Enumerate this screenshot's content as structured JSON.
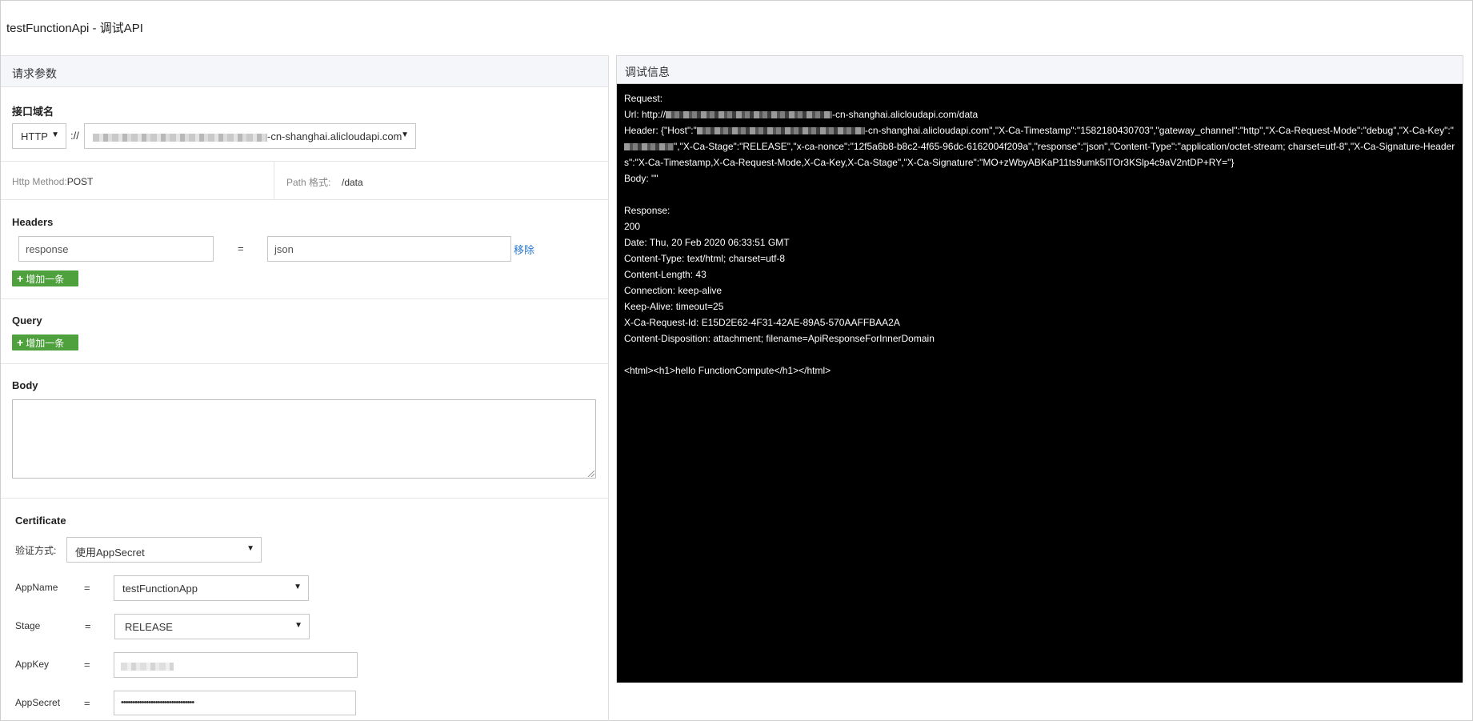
{
  "page": {
    "title": "testFunctionApi - 调试API"
  },
  "request_panel": {
    "heading": "请求参数",
    "domain": {
      "label": "接口域名",
      "protocol": "HTTP",
      "separator": "://",
      "host_suffix": "-cn-shanghai.alicloudapi.com"
    },
    "method": {
      "label": "Http Method:",
      "value": "POST"
    },
    "path": {
      "label": "Path 格式:",
      "value": "/data"
    },
    "headers": {
      "label": "Headers",
      "rows": [
        {
          "key": "response",
          "eq": "=",
          "value": "json",
          "remove": "移除"
        }
      ],
      "add": "增加一条"
    },
    "query": {
      "label": "Query",
      "add": "增加一条"
    },
    "body": {
      "label": "Body",
      "value": ""
    },
    "certificate": {
      "label": "Certificate",
      "auth_label": "验证方式:",
      "auth_value": "使用AppSecret",
      "app_name_label": "AppName",
      "app_name_value": "testFunctionApp",
      "stage_label": "Stage",
      "stage_value": "RELEASE",
      "app_key_label": "AppKey",
      "app_secret_label": "AppSecret",
      "app_secret_value": "••••••••••••••••••••••••••••••••",
      "eq": "="
    }
  },
  "debug_panel": {
    "heading": "调试信息",
    "request_label": "Request:",
    "url_prefix": "Url: http://",
    "url_suffix": "-cn-shanghai.alicloudapi.com/data",
    "header_prefix": "Header: {\"Host\":\"",
    "header_mid1": "-cn-shanghai.alicloudapi.com\",\"X-Ca-Timestamp\":\"1582180430703\",\"gateway_channel\":\"http\",\"X-Ca-Request-Mode\":\"debug\",\"X-Ca-Key\":\"",
    "header_mid2": "\",\"X-Ca-Stage\":\"RELEASE\",\"x-ca-nonce\":\"12f5a6b8-b8c2-4f65-96dc-6162004f209a\",\"response\":\"json\",\"Content-Type\":\"application/octet-stream; charset=utf-8\",\"X-Ca-Signature-Headers\":\"X-Ca-Timestamp,X-Ca-Request-Mode,X-Ca-Key,X-Ca-Stage\",\"X-Ca-Signature\":\"MO+zWbyABKaP11ts9umk5lTOr3KSlp4c9aV2ntDP+RY=\"}",
    "body_line": "Body: \"\"",
    "response_label": "Response:",
    "status": "200",
    "date": "Date: Thu, 20 Feb 2020 06:33:51 GMT",
    "content_type": "Content-Type: text/html; charset=utf-8",
    "content_length": "Content-Length: 43",
    "connection": "Connection: keep-alive",
    "keep_alive": "Keep-Alive: timeout=25",
    "request_id": "X-Ca-Request-Id: E15D2E62-4F31-42AE-89A5-570AAFFBAA2A",
    "disposition": "Content-Disposition: attachment; filename=ApiResponseForInnerDomain",
    "html_body": "<html><h1>hello FunctionCompute</h1></html>"
  }
}
